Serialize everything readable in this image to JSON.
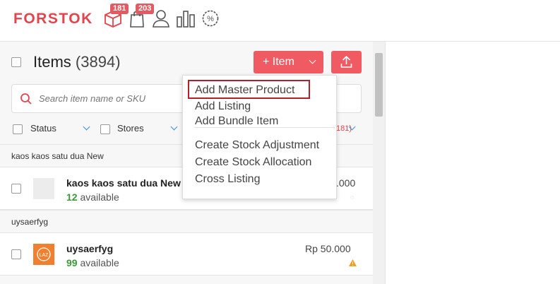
{
  "brand": {
    "logo": "FORSTOK",
    "color": "#e2454d"
  },
  "nav": {
    "icons": [
      "package-icon",
      "bag-icon",
      "user-icon",
      "bar-chart-icon",
      "promo-percent-icon"
    ],
    "badges": {
      "package": "181",
      "bag": "203"
    }
  },
  "items_panel": {
    "title": "Items",
    "count": "(3894)",
    "add_button_label": "+ Item",
    "search_placeholder": "Search item name or SKU",
    "filters": {
      "status": "Status",
      "stores": "Stores",
      "hidden_count": "181)"
    }
  },
  "dropdown": {
    "items": [
      "Add Master Product",
      "Add Listing",
      "Add Bundle Item"
    ],
    "items2": [
      "Create Stock Adjustment",
      "Create Stock Allocation",
      "Cross Listing"
    ]
  },
  "list": {
    "groups": [
      "kaos kaos satu dua New",
      "uysaerfyg"
    ],
    "rows": [
      {
        "name": "kaos kaos satu dua New",
        "available_count": "12",
        "available_label": "available",
        "price_partial": ".000"
      },
      {
        "name": "uysaerfyg",
        "available_count": "99",
        "available_label": "available",
        "price": "Rp 50.000",
        "thumb_text": "LAZ"
      }
    ]
  },
  "colors": {
    "accent": "#f05b63",
    "available_green": "#3a9a3a",
    "warning": "#f0a020",
    "highlight_box": "#b51f2a"
  }
}
